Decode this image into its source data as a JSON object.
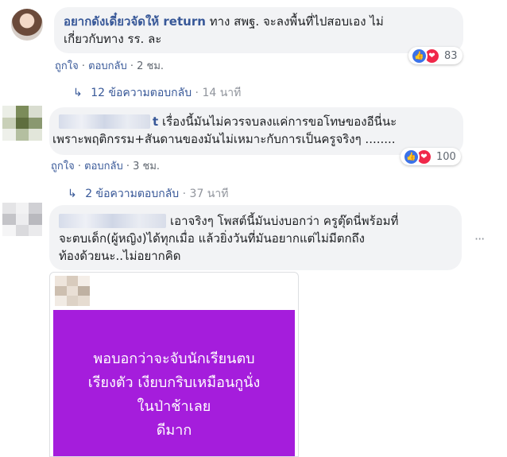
{
  "comments": [
    {
      "author": "อยากดังเดี๋ยวจัดให้ return",
      "text_line1": " ทาง สพฐ. จะลงพื้นที่ไปสอบเอง ไม่",
      "text_line2": "เกี่ยวกับทาง รร. ละ",
      "like_label": "ถูกใจ",
      "reply_label": "ตอบกลับ",
      "time": "2 ชม.",
      "reaction_count": "83",
      "replies_label": "12 ข้อความตอบกลับ",
      "replies_time": "14 นาที"
    },
    {
      "author_tail": "t",
      "text_line1": " เรื่องนี้มันไม่ควรจบลงแค่การขอโทษของอีนี่นะ",
      "text_line2": "เพราะพฤติกรรม+สันดานของมันไม่เหมาะกับการเป็นครูจริงๆ ........",
      "like_label": "ถูกใจ",
      "reply_label": "ตอบกลับ",
      "time": "3 ชม.",
      "reaction_count": "100",
      "replies_label": "2 ข้อความตอบกลับ",
      "replies_time": "37 นาที"
    },
    {
      "text_line1": "เอาจริงๆ โพสต์นี้มันบ่งบอกว่า ครูตุ๊ดนี่พร้อมที่",
      "text_line2": "จะตบเด็ก(ผู้หญิง)ได้ทุกเมื่อ แล้วยิ่งวันที่มันอยากแต่ไม่มีตกถึง",
      "text_line3": "ท้องด้วยนะ..ไม่อยากคิด",
      "more_icon": "more-dots-icon"
    }
  ],
  "attached_post": {
    "lines": [
      "พอบอกว่าจะจับนักเรียนตบ",
      "เรียงตัว เงียบกริบเหมือนกูนั่ง",
      "ในป่าช้าเลย",
      "ดีมาก"
    ],
    "background": "#a51ddc"
  },
  "colors": {
    "link": "#385898",
    "bubble": "#f2f3f5",
    "muted": "#606770",
    "like": "#3b72e8",
    "love": "#f0284a"
  }
}
